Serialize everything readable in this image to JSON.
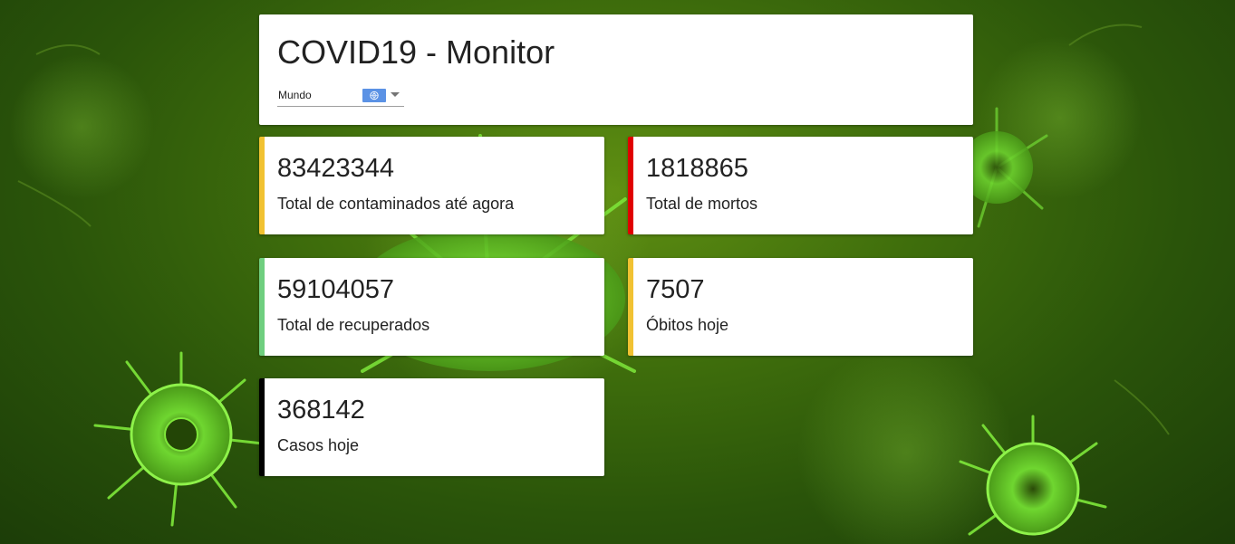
{
  "app": {
    "title": "COVID19 - Monitor"
  },
  "region_select": {
    "selected": "Mundo",
    "flag_icon": "un-flag-icon"
  },
  "stats": {
    "total_cases": {
      "value": "83423344",
      "label": "Total de contaminados até agora",
      "accent": "#f1c232"
    },
    "total_deaths": {
      "value": "1818865",
      "label": "Total de mortos",
      "accent": "#e00000"
    },
    "recovered": {
      "value": "59104057",
      "label": "Total de recuperados",
      "accent": "#6fcf7f"
    },
    "deaths_today": {
      "value": "7507",
      "label": "Óbitos hoje",
      "accent": "#f1c232"
    },
    "cases_today": {
      "value": "368142",
      "label": "Casos hoje",
      "accent": "#000000"
    }
  },
  "colors": {
    "background": "#3f6e0c",
    "virus": "#7ee83a",
    "flag": "#5b92e5"
  }
}
